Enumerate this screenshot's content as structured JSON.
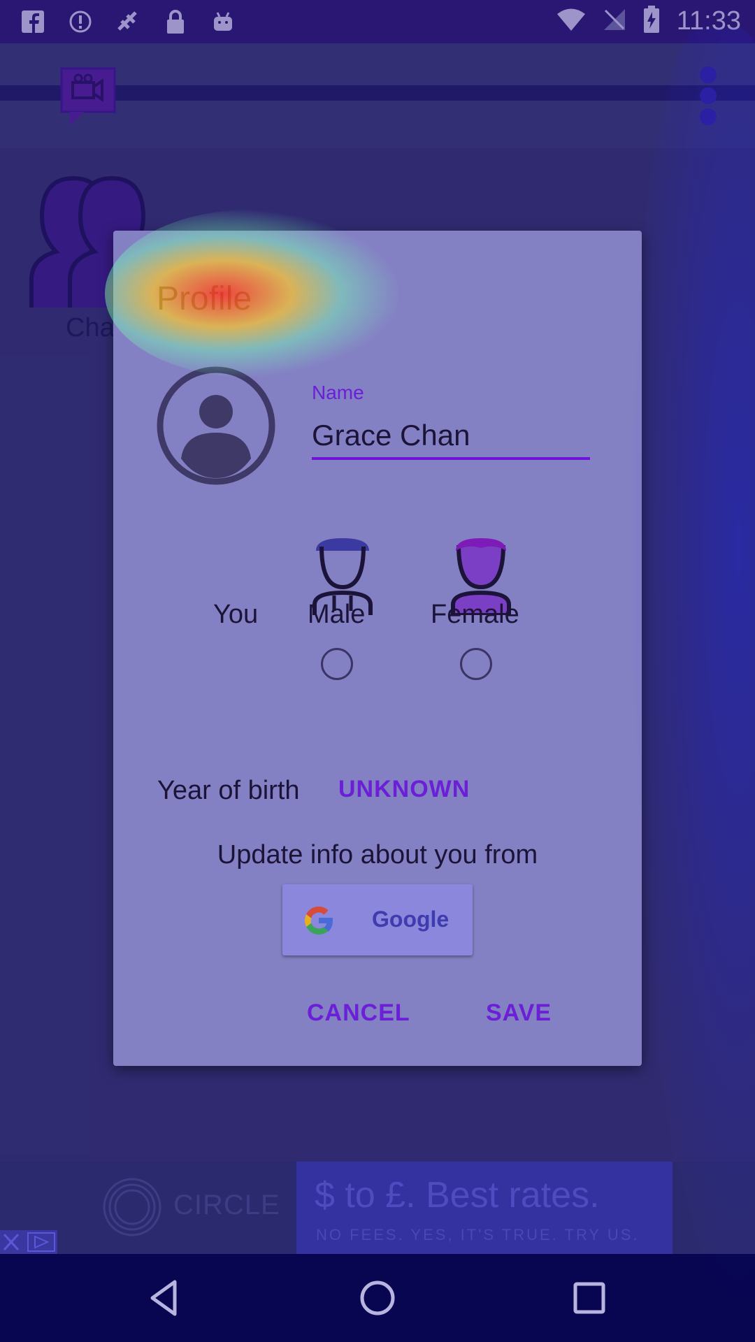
{
  "status_bar": {
    "time": "11:33",
    "left_icons": [
      "facebook-icon",
      "alert-icon",
      "satellite-icon",
      "lock-icon",
      "android-icon"
    ],
    "right_icons": [
      "wifi-icon",
      "no-signal-icon",
      "battery-charging-icon"
    ]
  },
  "background": {
    "list_item_label": "Cha"
  },
  "dialog": {
    "title": "Profile",
    "name_label": "Name",
    "name_value": "Grace Chan",
    "you_label": "You",
    "male_label": "Male",
    "female_label": "Female",
    "year_of_birth_label": "Year of birth",
    "year_of_birth_value": "UNKNOWN",
    "update_info_label": "Update info about you from",
    "google_button_label": "Google",
    "cancel_label": "CANCEL",
    "save_label": "SAVE"
  },
  "ad": {
    "brand": "CIRCLE",
    "headline": "$ to £. Best rates.",
    "subline": "NO FEES. YES, IT'S TRUE. TRY US."
  },
  "nav": {
    "icons": [
      "back-icon",
      "home-icon",
      "recents-icon"
    ]
  },
  "colors": {
    "accent": "#6b1fd6",
    "dialog_bg": "#8480c4",
    "status_bar": "#2a1470"
  }
}
